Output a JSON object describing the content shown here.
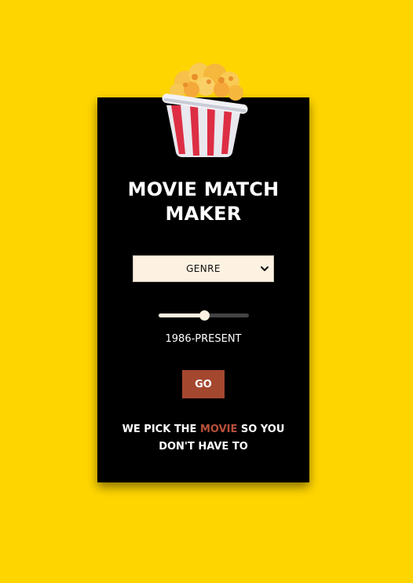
{
  "app": {
    "title_line1": "MOVIE MATCH",
    "title_line2": "MAKER"
  },
  "genre_select": {
    "selected": "GENRE"
  },
  "year_slider": {
    "value_fraction": 0.5,
    "label": "1986-PRESENT"
  },
  "go_button": {
    "label": "GO"
  },
  "tagline": {
    "part1": "WE PICK THE ",
    "highlight": "MOVIE",
    "part2": " SO YOU",
    "line2": "DON'T HAVE TO"
  },
  "colors": {
    "background": "#FFD500",
    "card": "#000000",
    "accent": "#A4472F",
    "highlight_text": "#B8503A",
    "input_bg": "#FDF1E1"
  },
  "icons": {
    "logo": "popcorn-icon",
    "select_arrow": "chevron-down-icon"
  }
}
